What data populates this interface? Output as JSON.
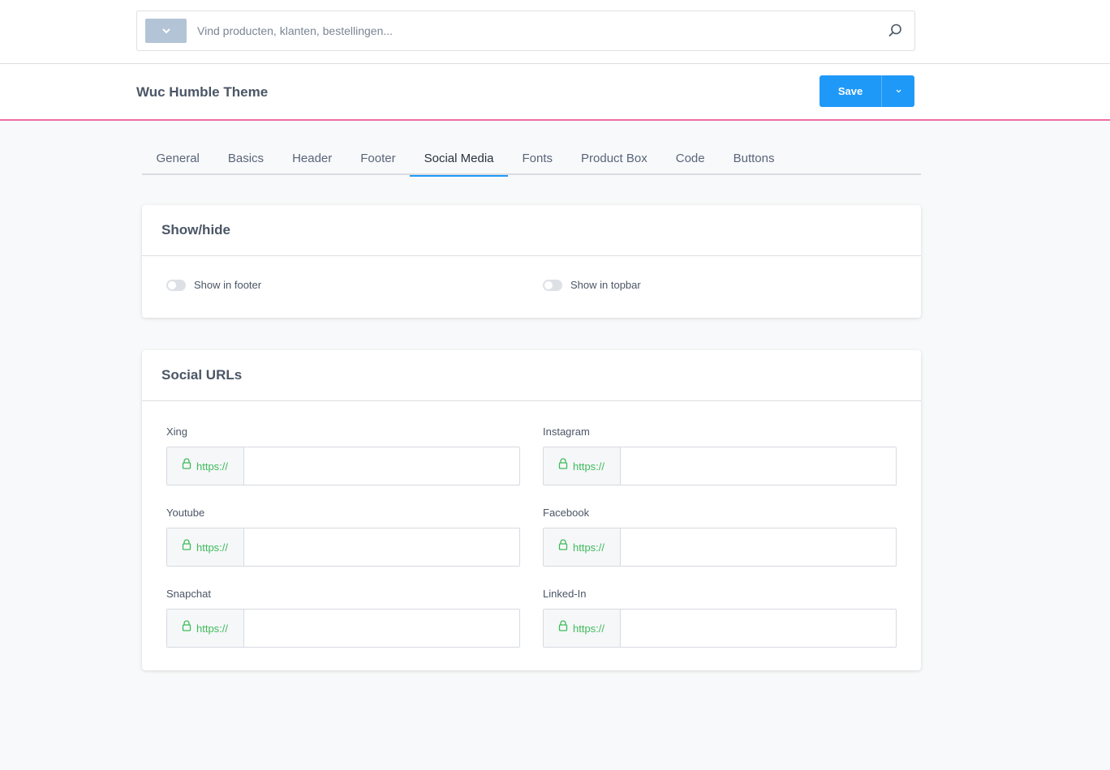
{
  "search": {
    "placeholder": "Vind producten, klanten, bestellingen..."
  },
  "page": {
    "title": "Wuc Humble Theme"
  },
  "toolbar": {
    "save_label": "Save"
  },
  "tabs": [
    {
      "label": "General"
    },
    {
      "label": "Basics"
    },
    {
      "label": "Header"
    },
    {
      "label": "Footer"
    },
    {
      "label": "Social Media",
      "active": true
    },
    {
      "label": "Fonts"
    },
    {
      "label": "Product Box"
    },
    {
      "label": "Code"
    },
    {
      "label": "Buttons"
    }
  ],
  "showhide": {
    "title": "Show/hide",
    "toggles": [
      {
        "label": "Show in footer",
        "on": false
      },
      {
        "label": "Show in topbar",
        "on": false
      }
    ]
  },
  "social": {
    "title": "Social URLs",
    "fields": [
      {
        "label": "Xing",
        "prefix": "https://",
        "value": ""
      },
      {
        "label": "Instagram",
        "prefix": "https://",
        "value": ""
      },
      {
        "label": "Youtube",
        "prefix": "https://",
        "value": ""
      },
      {
        "label": "Facebook",
        "prefix": "https://",
        "value": ""
      },
      {
        "label": "Snapchat",
        "prefix": "https://",
        "value": ""
      },
      {
        "label": "Linked-In",
        "prefix": "https://",
        "value": ""
      }
    ]
  },
  "colors": {
    "accent": "#1f99f7",
    "header_border": "#f06ba6",
    "prefix_text": "#3dbb5a",
    "dropdown_bg": "#b3c4d6"
  },
  "icons": {
    "search": "search-icon",
    "dropdown": "chevron-down-icon",
    "lock": "lock-icon"
  }
}
